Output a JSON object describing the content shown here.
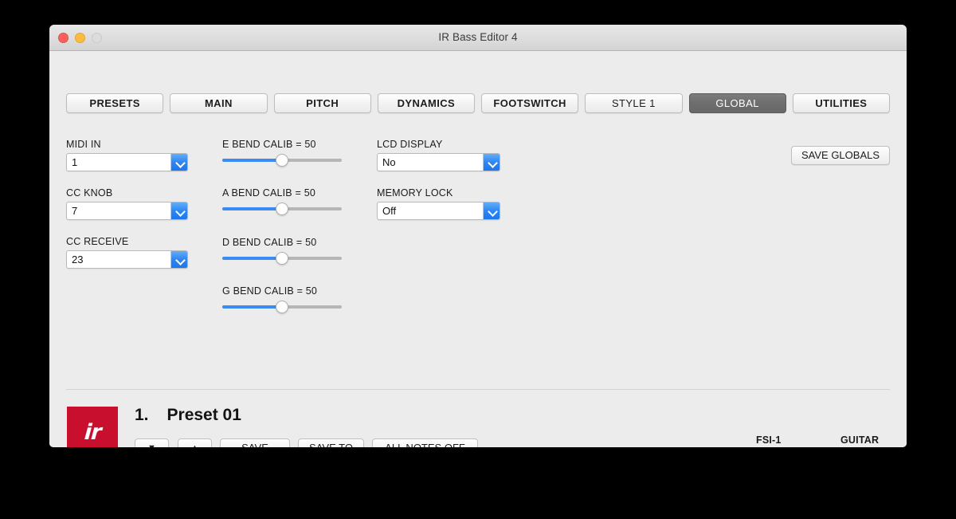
{
  "window": {
    "title": "IR Bass Editor 4",
    "traffic_lights": [
      "close",
      "minimize",
      "zoom"
    ]
  },
  "tabs": [
    {
      "label": "PRESETS",
      "active": false,
      "bold": true
    },
    {
      "label": "MAIN",
      "active": false,
      "bold": true
    },
    {
      "label": "PITCH",
      "active": false,
      "bold": true
    },
    {
      "label": "DYNAMICS",
      "active": false,
      "bold": true
    },
    {
      "label": "FOOTSWITCH",
      "active": false,
      "bold": true
    },
    {
      "label": "STYLE 1",
      "active": false,
      "bold": false
    },
    {
      "label": "GLOBAL",
      "active": true,
      "bold": false
    },
    {
      "label": "UTILITIES",
      "active": false,
      "bold": true
    }
  ],
  "column_left": {
    "midi_in": {
      "label": "MIDI IN",
      "value": "1"
    },
    "cc_knob": {
      "label": "CC KNOB",
      "value": "7"
    },
    "cc_receive": {
      "label": "CC RECEIVE",
      "value": "23"
    }
  },
  "column_sliders": [
    {
      "label": "E BEND CALIB = 50",
      "value": 50,
      "min": 0,
      "max": 100
    },
    {
      "label": "A BEND CALIB = 50",
      "value": 50,
      "min": 0,
      "max": 100
    },
    {
      "label": "D BEND CALIB = 50",
      "value": 50,
      "min": 0,
      "max": 100
    },
    {
      "label": "G BEND CALIB = 50",
      "value": 50,
      "min": 0,
      "max": 100
    }
  ],
  "column_right": {
    "lcd_display": {
      "label": "LCD DISPLAY",
      "value": "No"
    },
    "memory_lock": {
      "label": "MEMORY LOCK",
      "value": "Off"
    }
  },
  "save_globals_label": "SAVE GLOBALS",
  "footer": {
    "logo_text": "ir",
    "preset_number": "1.",
    "preset_name": "Preset 01",
    "buttons": {
      "down": "▼",
      "up": "▲",
      "save": "SAVE",
      "save_to": "SAVE TO",
      "all_notes_off": "ALL NOTES OFF"
    },
    "status": [
      {
        "label": "FSI-1"
      },
      {
        "label": "GUITAR"
      }
    ]
  },
  "colors": {
    "accent_blue": "#3a8cf4",
    "brand_red": "#c8102e",
    "status_red": "#e1162c",
    "active_tab": "#6e6e6e",
    "window_bg": "#ececec"
  }
}
